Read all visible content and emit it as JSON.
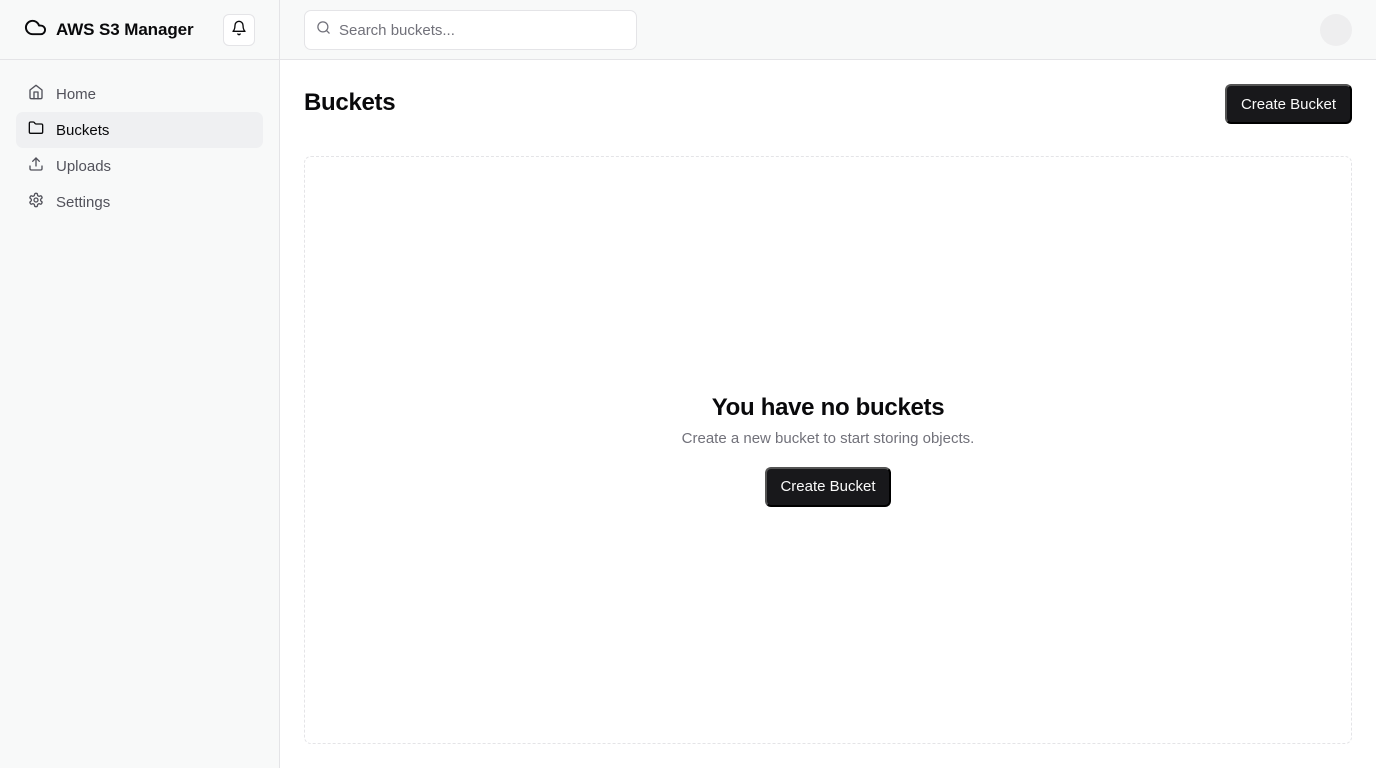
{
  "app": {
    "title": "AWS S3 Manager"
  },
  "icons": {
    "brand": "cloud-icon",
    "notifications": "bell-icon",
    "search": "search-icon"
  },
  "sidebar": {
    "items": [
      {
        "label": "Home",
        "icon": "home-icon",
        "active": false
      },
      {
        "label": "Buckets",
        "icon": "folder-icon",
        "active": true
      },
      {
        "label": "Uploads",
        "icon": "upload-icon",
        "active": false
      },
      {
        "label": "Settings",
        "icon": "gear-icon",
        "active": false
      }
    ]
  },
  "topbar": {
    "search_placeholder": "Search buckets..."
  },
  "main": {
    "title": "Buckets",
    "create_label": "Create Bucket",
    "empty": {
      "title": "You have no buckets",
      "subtitle": "Create a new bucket to start storing objects.",
      "create_label": "Create Bucket"
    }
  },
  "colors": {
    "primary": "#18181b",
    "sidebar_bg": "#f8f9f9",
    "active_bg": "#eff0f2",
    "muted_text": "#71717a",
    "border": "#e4e4e7"
  }
}
